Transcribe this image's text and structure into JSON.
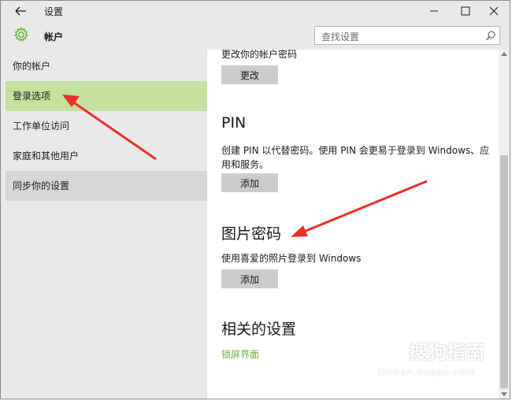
{
  "window": {
    "title": "设置",
    "minimize_glyph": "—",
    "maximize_glyph": "☐",
    "close_glyph": "✕"
  },
  "header": {
    "title": "帐户",
    "icon": "gear-icon"
  },
  "search": {
    "placeholder": "查找设置",
    "icon": "search-icon"
  },
  "sidebar": {
    "items": [
      {
        "label": "你的帐户",
        "state": "normal"
      },
      {
        "label": "登录选项",
        "state": "selected"
      },
      {
        "label": "工作单位访问",
        "state": "normal"
      },
      {
        "label": "家庭和其他用户",
        "state": "normal"
      },
      {
        "label": "同步你的设置",
        "state": "hover"
      }
    ]
  },
  "content": {
    "password_section": {
      "cut_text": "更改你的帐户密码",
      "button": "更改"
    },
    "pin_section": {
      "heading": "PIN",
      "description": "创建 PIN 以代替密码。使用 PIN 会更易于登录到 Windows、应用和服务。",
      "button": "添加"
    },
    "picture_password_section": {
      "heading": "图片密码",
      "description": "使用喜爱的照片登录到 Windows",
      "button": "添加"
    },
    "related_section": {
      "heading": "相关的设置",
      "link": "锁屏界面"
    }
  },
  "watermark": {
    "text": "搜狗指南",
    "subtext": "zhinan.sogou.com"
  },
  "colors": {
    "accent": "#68b336",
    "selected_bg": "#c5e09f",
    "chrome_bg": "#e9e9e9",
    "button_bg": "#cccccc",
    "annotation_arrow": "#e8302a"
  }
}
